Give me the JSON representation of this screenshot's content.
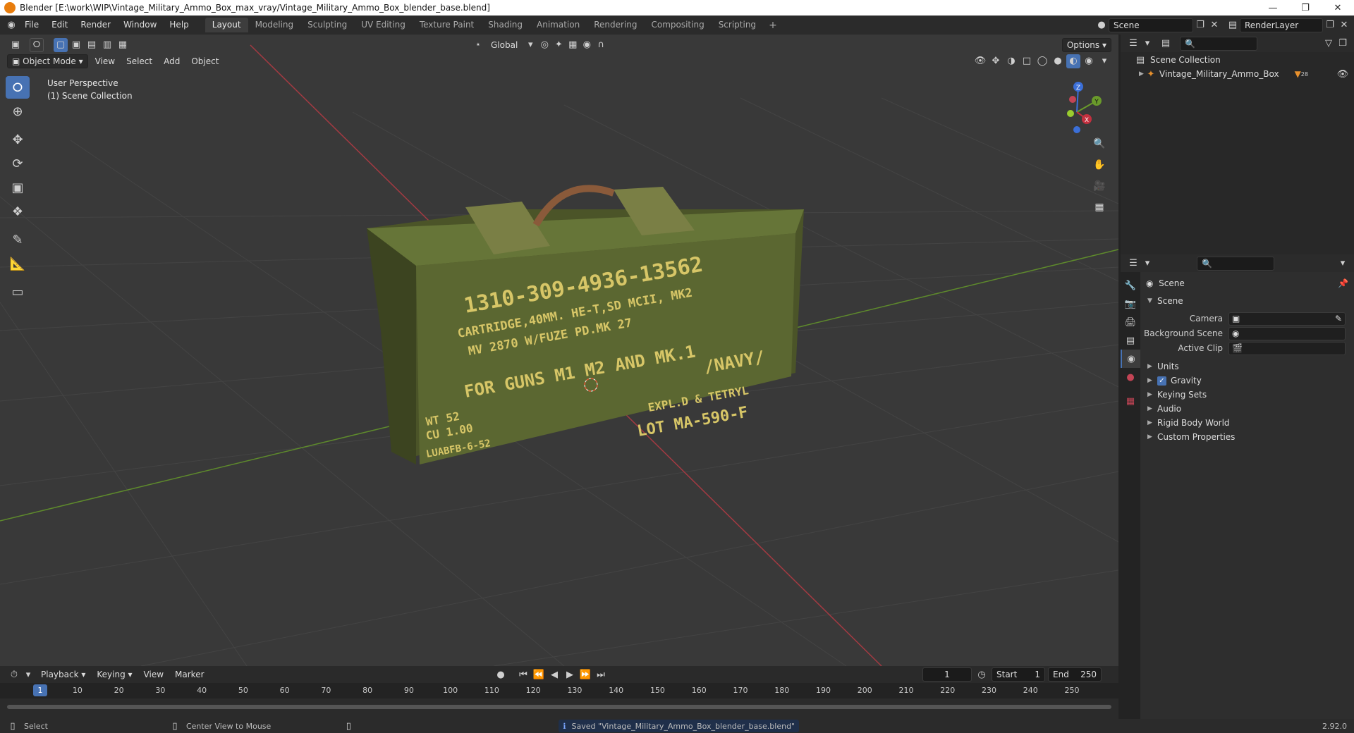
{
  "window": {
    "title": "Blender [E:\\work\\WIP\\Vintage_Military_Ammo_Box_max_vray/Vintage_Military_Ammo_Box_blender_base.blend]"
  },
  "menu": {
    "items": [
      "File",
      "Edit",
      "Render",
      "Window",
      "Help"
    ]
  },
  "workspaces": {
    "tabs": [
      "Layout",
      "Modeling",
      "Sculpting",
      "UV Editing",
      "Texture Paint",
      "Shading",
      "Animation",
      "Rendering",
      "Compositing",
      "Scripting"
    ],
    "active": "Layout"
  },
  "top_right": {
    "scene": "Scene",
    "view_layer": "RenderLayer"
  },
  "viewport": {
    "transform_orientation": "Global",
    "options_label": "Options",
    "mode": "Object Mode",
    "menus": [
      "View",
      "Select",
      "Add",
      "Object"
    ],
    "view_name": "User Perspective",
    "collection_info": "(1) Scene Collection",
    "box_text": {
      "line1": "1310-309-4936-13562",
      "line2": "CARTRIDGE,40MM.  HE-T,SD MCII, MK2",
      "line3": "MV 2870 W/FUZE PD.MK 27",
      "line4": "FOR GUNS M1 M2 AND MK.1",
      "line5": "/NAVY/",
      "line6": "EXPL.D & TETRYL",
      "line7": "LOT MA-590-F",
      "line8": "WT 52",
      "line9": "CU 1.00",
      "line10": "LUABFB-6-52"
    },
    "gizmo_axes": {
      "z": "Z",
      "y": "Y",
      "x": "X"
    }
  },
  "timeline": {
    "menus": [
      "Playback",
      "Keying",
      "View",
      "Marker"
    ],
    "current_frame": "1",
    "start_label": "Start",
    "start": "1",
    "end_label": "End",
    "end": "250",
    "ticks": [
      "1",
      "10",
      "20",
      "30",
      "40",
      "50",
      "60",
      "70",
      "80",
      "90",
      "100",
      "110",
      "120",
      "130",
      "140",
      "150",
      "160",
      "170",
      "180",
      "190",
      "200",
      "210",
      "220",
      "230",
      "240",
      "250"
    ]
  },
  "statusbar": {
    "select": "Select",
    "center": "Center View to Mouse",
    "message": "Saved \"Vintage_Military_Ammo_Box_blender_base.blend\"",
    "version": "2.92.0"
  },
  "outliner": {
    "root": "Scene Collection",
    "item": "Vintage_Military_Ammo_Box",
    "item_badge": "28"
  },
  "properties": {
    "header": "Scene",
    "panel": "Scene",
    "camera_label": "Camera",
    "background_label": "Background Scene",
    "clip_label": "Active Clip",
    "subpanels": [
      "Units",
      "Gravity",
      "Keying Sets",
      "Audio",
      "Rigid Body World",
      "Custom Properties"
    ]
  },
  "colors": {
    "accent": "#4772b3",
    "x_axis": "#c3303f",
    "y_axis": "#6a9a2b",
    "box_green": "#5d6a34",
    "stencil": "#d7c667"
  }
}
